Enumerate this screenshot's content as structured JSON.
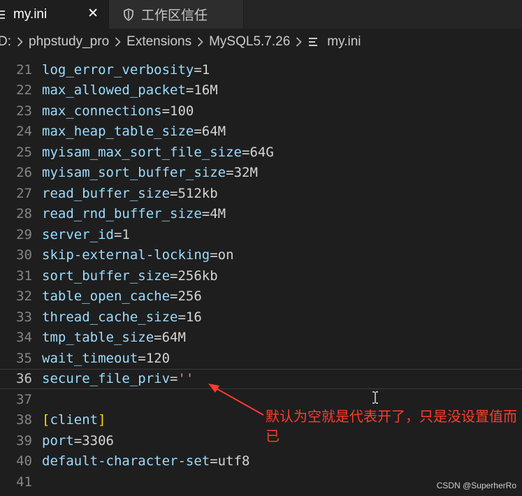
{
  "tabs": [
    {
      "label": "my.ini",
      "active": true,
      "close_glyph": "✕"
    },
    {
      "label": "工作区信任",
      "active": false,
      "icon": "shield-icon"
    }
  ],
  "breadcrumb": {
    "items": [
      "D:",
      "phpstudy_pro",
      "Extensions",
      "MySQL5.7.26",
      "my.ini"
    ],
    "file_icon": "settings-file-icon"
  },
  "editor": {
    "lines": [
      {
        "num": "21",
        "key": "log_error_verbosity",
        "value": "1"
      },
      {
        "num": "22",
        "key": "max_allowed_packet",
        "value": "16M"
      },
      {
        "num": "23",
        "key": "max_connections",
        "value": "100"
      },
      {
        "num": "24",
        "key": "max_heap_table_size",
        "value": "64M"
      },
      {
        "num": "25",
        "key": "myisam_max_sort_file_size",
        "value": "64G"
      },
      {
        "num": "26",
        "key": "myisam_sort_buffer_size",
        "value": "32M"
      },
      {
        "num": "27",
        "key": "read_buffer_size",
        "value": "512kb"
      },
      {
        "num": "28",
        "key": "read_rnd_buffer_size",
        "value": "4M"
      },
      {
        "num": "29",
        "key": "server_id",
        "value": "1"
      },
      {
        "num": "30",
        "key": "skip-external-locking",
        "value": "on"
      },
      {
        "num": "31",
        "key": "sort_buffer_size",
        "value": "256kb"
      },
      {
        "num": "32",
        "key": "table_open_cache",
        "value": "256"
      },
      {
        "num": "33",
        "key": "thread_cache_size",
        "value": "16"
      },
      {
        "num": "34",
        "key": "tmp_table_size",
        "value": "64M"
      },
      {
        "num": "35",
        "key": "wait_timeout",
        "value": "120"
      },
      {
        "num": "36",
        "key": "secure_file_priv",
        "value": "''",
        "current": true
      },
      {
        "num": "37"
      },
      {
        "num": "38",
        "section": "client"
      },
      {
        "num": "39",
        "key": "port",
        "value": "3306"
      },
      {
        "num": "40",
        "key": "default-character-set",
        "value": "utf8"
      },
      {
        "num": "41"
      }
    ]
  },
  "annotation": {
    "text": "默认为空就是代表开了，只是没设置值而已",
    "color": "#ff3b30"
  },
  "watermark": "CSDN @SuperherRo"
}
